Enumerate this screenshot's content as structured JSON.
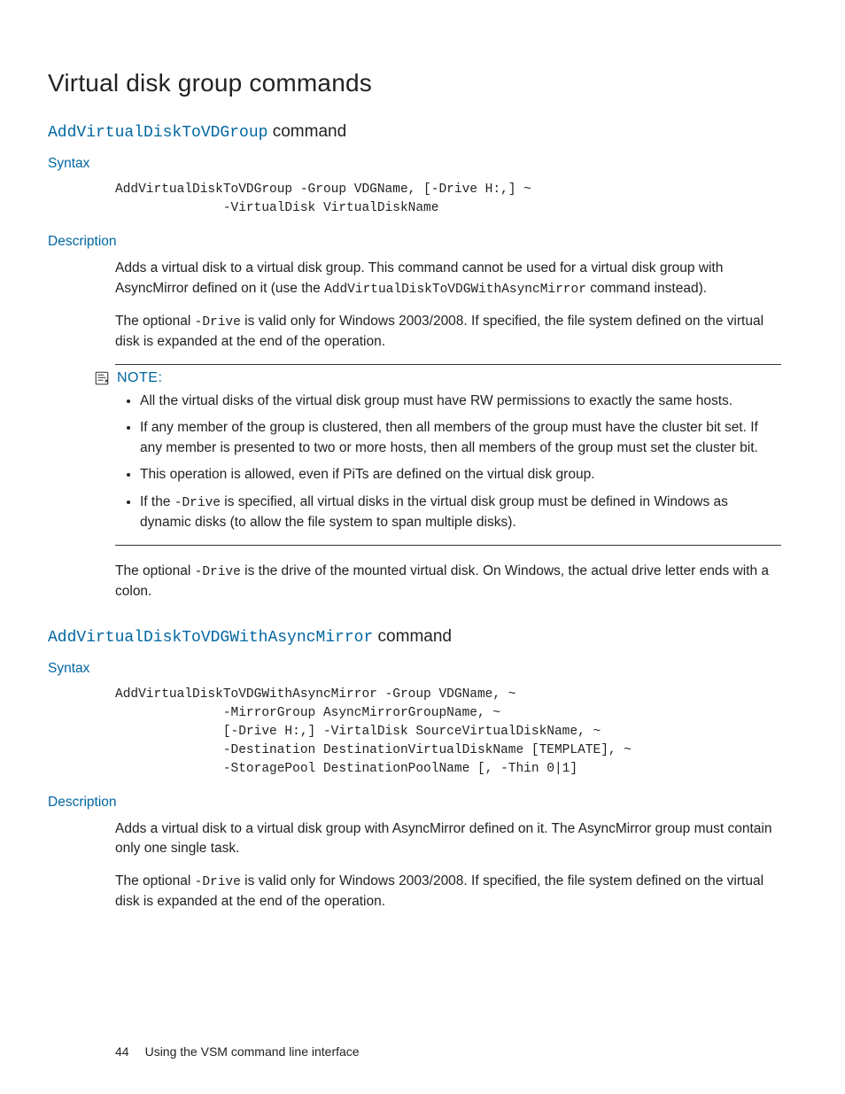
{
  "title": "Virtual disk group commands",
  "section1": {
    "cmd": "AddVirtualDiskToVDGroup",
    "cmd_suffix": " command",
    "syntax_label": "Syntax",
    "code": "AddVirtualDiskToVDGroup -Group VDGName, [-Drive H:,] ~\n              -VirtualDisk VirtualDiskName",
    "desc_label": "Description",
    "desc_p1_a": "Adds a virtual disk to a virtual disk group. This command cannot be used for a virtual disk group with AsyncMirror defined on it (use the ",
    "desc_p1_code": "AddVirtualDiskToVDGWithAsyncMirror",
    "desc_p1_b": " command instead).",
    "desc_p2_a": "The optional ",
    "desc_p2_code": "-Drive",
    "desc_p2_b": " is valid only for Windows 2003/2008. If specified, the file system defined on the virtual disk is expanded at the end of the operation.",
    "note_label": "NOTE:",
    "note_items": [
      {
        "text": "All the virtual disks of the virtual disk group must have RW permissions to exactly the same hosts."
      },
      {
        "text": "If any member of the group is clustered, then all members of the group must have the cluster bit set. If any member is presented to two or more hosts, then all members of the group must set the cluster bit."
      },
      {
        "text": "This operation is allowed, even if PiTs are defined on the virtual disk group."
      },
      {
        "pre": "If the ",
        "code": "-Drive",
        "post": " is specified, all virtual disks in the virtual disk group must be defined in Windows as dynamic disks (to allow the file system to span multiple disks)."
      }
    ],
    "desc_p3_a": "The optional ",
    "desc_p3_code": "-Drive",
    "desc_p3_b": " is the drive of the mounted virtual disk. On Windows, the actual drive letter ends with a colon."
  },
  "section2": {
    "cmd": "AddVirtualDiskToVDGWithAsyncMirror",
    "cmd_suffix": " command",
    "syntax_label": "Syntax",
    "code": "AddVirtualDiskToVDGWithAsyncMirror -Group VDGName, ~\n              -MirrorGroup AsyncMirrorGroupName, ~\n              [-Drive H:,] -VirtalDisk SourceVirtualDiskName, ~\n              -Destination DestinationVirtualDiskName [TEMPLATE], ~\n              -StoragePool DestinationPoolName [, -Thin 0|1]",
    "desc_label": "Description",
    "desc_p1": "Adds a virtual disk to a virtual disk group with AsyncMirror defined on it. The AsyncMirror group must contain only one single task.",
    "desc_p2_a": "The optional ",
    "desc_p2_code": "-Drive",
    "desc_p2_b": " is valid only for Windows 2003/2008. If specified, the file system defined on the virtual disk is expanded at the end of the operation."
  },
  "footer": {
    "page": "44",
    "text": "Using the VSM command line interface"
  }
}
